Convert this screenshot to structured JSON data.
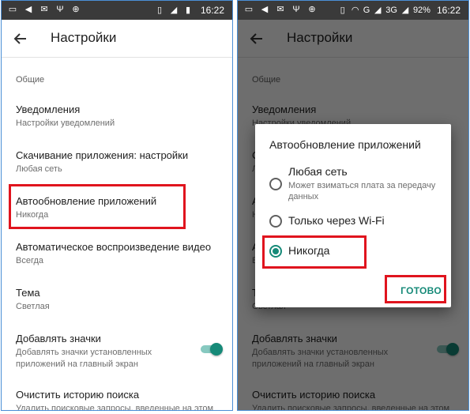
{
  "status_bar": {
    "time": "16:22",
    "battery_percent": "92%",
    "network": "3G",
    "network_alt": "G"
  },
  "app_bar": {
    "title": "Настройки"
  },
  "settings": {
    "section_general": "Общие",
    "items": [
      {
        "title": "Уведомления",
        "subtitle": "Настройки уведомлений"
      },
      {
        "title": "Скачивание приложения: настройки",
        "subtitle": "Любая сеть"
      },
      {
        "title": "Автообновление приложений",
        "subtitle": "Никогда"
      },
      {
        "title": "Автоматическое воспроизведение видео",
        "subtitle": "Всегда"
      },
      {
        "title": "Тема",
        "subtitle": "Светлая"
      },
      {
        "title": "Добавлять значки",
        "subtitle": "Добавлять значки установленных приложений на главный экран",
        "toggle_on": true
      },
      {
        "title": "Очистить историю поиска",
        "subtitle": "Удалить поисковые запросы, введенные на этом"
      }
    ]
  },
  "dialog": {
    "title": "Автообновление приложений",
    "options": [
      {
        "label": "Любая сеть",
        "sublabel": "Может взиматься плата за передачу данных",
        "checked": false
      },
      {
        "label": "Только через Wi-Fi",
        "checked": false
      },
      {
        "label": "Никогда",
        "checked": true
      }
    ],
    "done_label": "ГОТОВО"
  },
  "colors": {
    "accent": "#168a78",
    "highlight": "#e0141e",
    "status_bar": "#3a3a3a",
    "border": "#4a8fd6"
  }
}
